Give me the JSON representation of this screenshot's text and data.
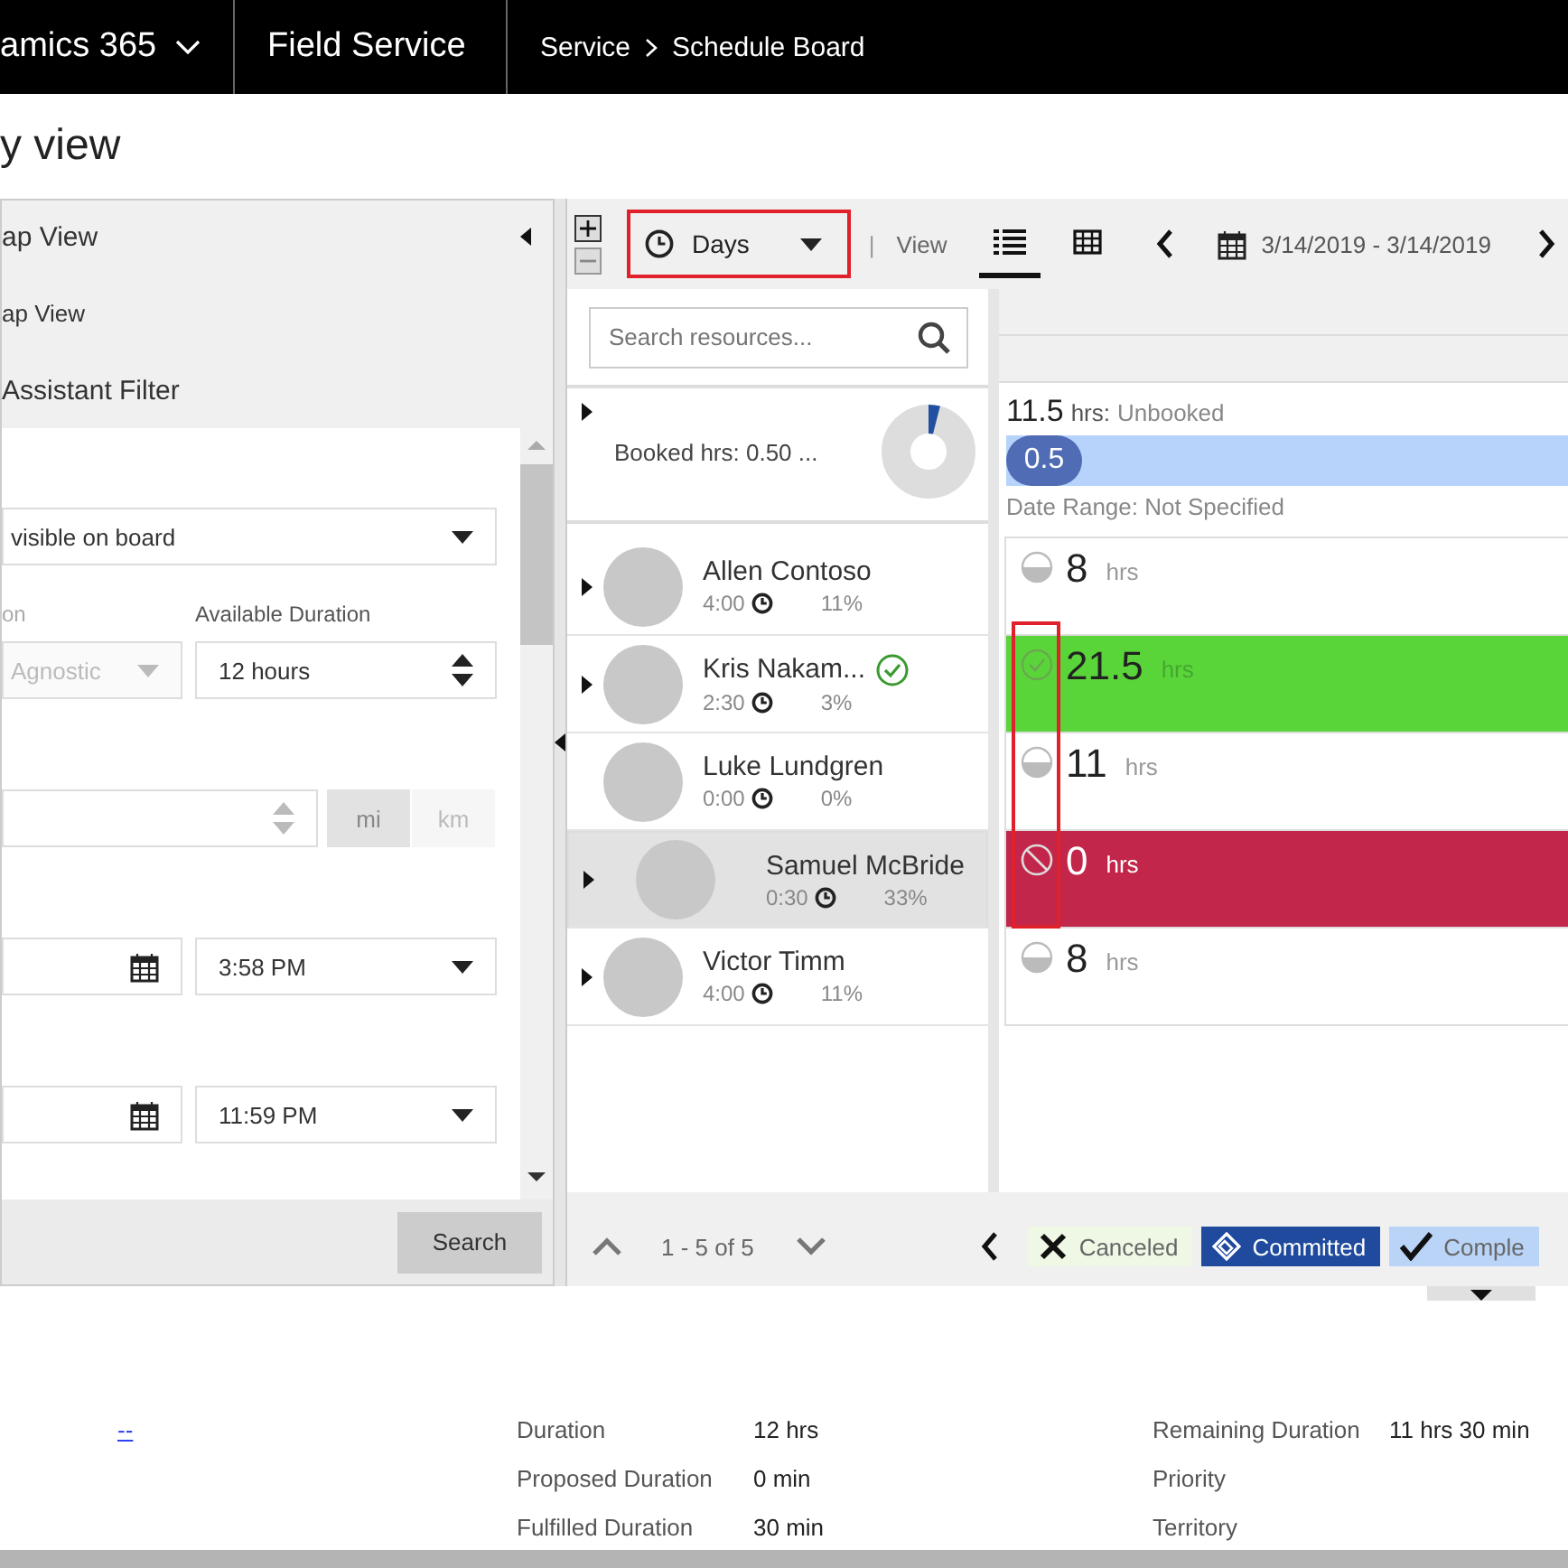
{
  "top_bar": {
    "app_name": "amics 365",
    "module": "Field Service",
    "breadcrumb": [
      "Service",
      "Schedule Board"
    ]
  },
  "page_title": "y view",
  "filter_panel": {
    "header": "ap View",
    "item": "ap View",
    "filter_title": "Assistant Filter",
    "visibility_select": "visible on board",
    "column_label": "on",
    "available_duration_label": "Available Duration",
    "type_select": {
      "value": "Agnostic",
      "disabled": true
    },
    "available_duration": "12 hours",
    "distance_units": [
      {
        "label": "mi",
        "selected": true
      },
      {
        "label": "km",
        "selected": false
      }
    ],
    "start_time": "3:58 PM",
    "end_time": "11:59 PM",
    "search_button": "Search"
  },
  "schedule": {
    "toolbar": {
      "time_scale": "Days",
      "highlighted": true,
      "view_label": "View",
      "separator": "|",
      "views": [
        {
          "kind": "list",
          "selected": true
        },
        {
          "kind": "grid",
          "selected": false
        }
      ],
      "date_range": "3/14/2019 - 3/14/2019"
    },
    "resource_search": {
      "placeholder": "Search resources..."
    },
    "summary": {
      "booked": "Booked hrs: 0.50 ...",
      "level": 0.04,
      "unbooked_value": "11.5",
      "unbooked_unit": "hrs:",
      "unbooked_label": "Unbooked",
      "booked_pill": "0.5",
      "date_range": "Date Range: Not Specified"
    },
    "resources": [
      {
        "name": "Allen Contoso",
        "time": "4:00",
        "percent": "11%",
        "expandable": true,
        "selected": false,
        "verified": false
      },
      {
        "name": "Kris Nakam...",
        "time": "2:30",
        "percent": "3%",
        "expandable": true,
        "selected": false,
        "verified": true
      },
      {
        "name": "Luke Lundgren",
        "time": "0:00",
        "percent": "0%",
        "expandable": false,
        "selected": false,
        "verified": false
      },
      {
        "name": "Samuel McBride",
        "time": "0:30",
        "percent": "33%",
        "expandable": true,
        "selected": true,
        "verified": false
      },
      {
        "name": "Victor Timm",
        "time": "4:00",
        "percent": "11%",
        "expandable": true,
        "selected": false,
        "verified": false
      }
    ],
    "cells_highlighted": true,
    "cells": [
      {
        "value": "8",
        "unit": "hrs",
        "kind": "partial",
        "color": "#ffffff"
      },
      {
        "value": "21.5",
        "unit": "hrs",
        "kind": "confirmed",
        "color": "#5ad539"
      },
      {
        "value": "11",
        "unit": "hrs",
        "kind": "partial",
        "color": "#ffffff"
      },
      {
        "value": "0",
        "unit": "hrs",
        "kind": "blocked",
        "color": "#c2264a"
      },
      {
        "value": "8",
        "unit": "hrs",
        "kind": "partial",
        "color": "#ffffff"
      }
    ],
    "pager": "1 - 5 of 5",
    "legend": [
      {
        "label": "Canceled",
        "kind": "canceled",
        "color": "#eef8e4"
      },
      {
        "label": "Committed",
        "kind": "committed",
        "color": "#1f4a9e"
      },
      {
        "label": "Comple",
        "kind": "completed",
        "color": "#b9d4f6"
      }
    ]
  },
  "details": {
    "link": "--",
    "fields": [
      {
        "label": "Duration",
        "value": "12 hrs"
      },
      {
        "label": "Proposed Duration",
        "value": "0 min"
      },
      {
        "label": "Fulfilled Duration",
        "value": "30 min"
      }
    ],
    "fields_right": [
      {
        "label": "Remaining Duration",
        "value": "11 hrs 30 min"
      },
      {
        "label": "Priority"
      },
      {
        "label": "Territory"
      }
    ]
  }
}
